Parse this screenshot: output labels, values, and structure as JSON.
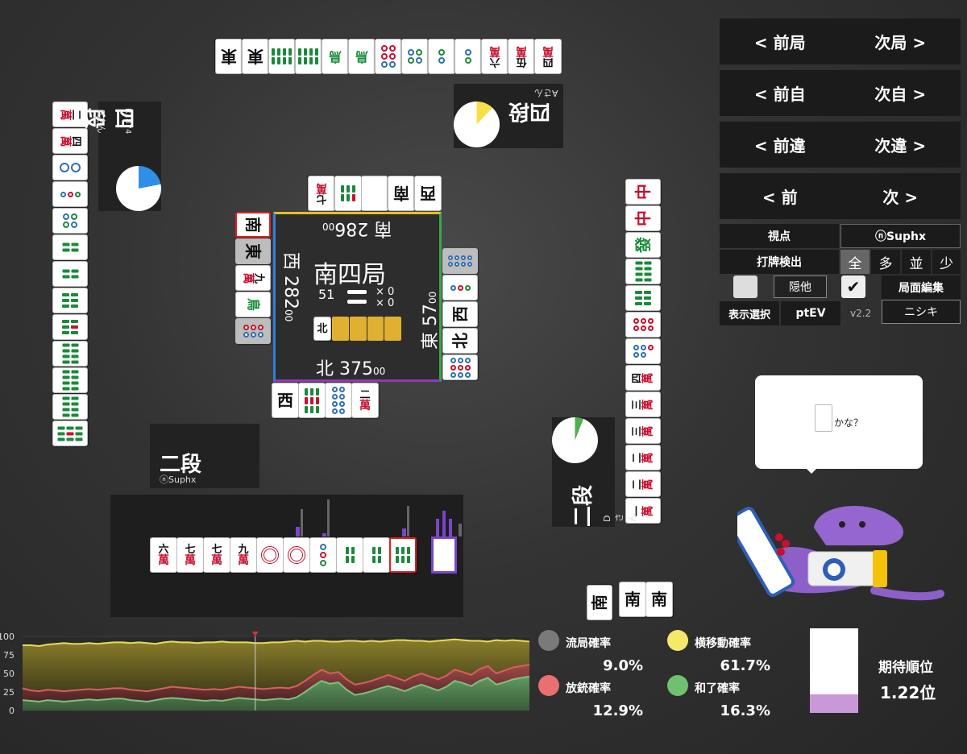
{
  "players": {
    "top": {
      "rank": "四段",
      "name": "Aさん"
    },
    "left": {
      "rank": "四段",
      "name": "Bさん",
      "rating": "R1874"
    },
    "right": {
      "rank": "二段",
      "name": "Dさん"
    },
    "self": {
      "rank": "二段",
      "name": "ⓝSuphx"
    }
  },
  "pies": {
    "top": {
      "fraction": 0.12,
      "color": "#f5e04a"
    },
    "left": {
      "fraction": 0.22,
      "color": "#2f8fe8"
    },
    "right": {
      "fraction": 0.06,
      "color": "#4caf50"
    }
  },
  "center": {
    "round": "南四局",
    "honba": "51",
    "riichi_sticks": "× 0",
    "honba_sticks": "× 0",
    "south_label": "南",
    "south_score": "286",
    "west_label": "西",
    "west_score": "282",
    "east_label": "東",
    "east_score": "57",
    "north_label": "北",
    "north_score": "375",
    "score_suffix": "00",
    "dora_indicator": "北"
  },
  "nav": {
    "prev_round": "< 前局",
    "next_round": "次局 >",
    "prev_self": "< 前自",
    "next_self": "次自 >",
    "prev_diff": "< 前違",
    "next_diff": "次違 >",
    "prev": "< 前",
    "next": "次 >"
  },
  "controls": {
    "viewpoint_label": "視点",
    "viewpoint_value": "ⓝSuphx",
    "discard_detect_label": "打牌検出",
    "filter_all": "全",
    "filter_many": "多",
    "filter_avg": "並",
    "filter_few": "少",
    "hide_others": "隠他",
    "board_edit": "局面編集",
    "display_select": "表示選択",
    "pt_ev": "ptEV",
    "version": "v2.2",
    "nishiki": "ニシキ"
  },
  "bubble": {
    "text": "かな？"
  },
  "stats": {
    "draw_label": "流局確率",
    "draw_value": "9.0%",
    "draw_color": "#7a7a7a",
    "move_label": "横移動確率",
    "move_value": "61.7%",
    "move_color": "#f5e96a",
    "deal_in_label": "放銃確率",
    "deal_in_value": "12.9%",
    "deal_in_color": "#e87070",
    "win_label": "和了確率",
    "win_value": "16.3%",
    "win_color": "#70c070",
    "expected_rank_label": "期待順位",
    "expected_rank_value": "1.22位",
    "expected_rank_fraction": 0.22
  },
  "chart_data": {
    "type": "area",
    "ylim": [
      0,
      100
    ],
    "yticks": [
      "100",
      "75",
      "50",
      "25",
      "0"
    ],
    "marker_index": 28,
    "series": [
      {
        "name": "",
        "color": "#e6dc5a",
        "values": [
          88,
          88,
          87,
          89,
          90,
          91,
          90,
          90,
          91,
          90,
          91,
          92,
          92,
          91,
          92,
          91,
          90,
          92,
          93,
          92,
          92,
          91,
          92,
          92,
          93,
          92,
          92,
          92,
          91,
          91,
          92,
          92,
          93,
          94,
          93,
          94,
          94,
          93,
          93,
          94,
          94,
          93,
          94,
          93,
          94,
          95,
          95,
          94,
          94,
          93,
          94,
          95,
          96,
          95,
          94,
          94,
          93,
          95,
          94,
          95,
          94,
          93
        ]
      },
      {
        "name": "",
        "color": "#d86060",
        "values": [
          30,
          27,
          26,
          28,
          27,
          26,
          27,
          28,
          29,
          28,
          29,
          30,
          30,
          28,
          27,
          26,
          28,
          30,
          32,
          31,
          30,
          29,
          28,
          29,
          28,
          30,
          32,
          31,
          30,
          29,
          30,
          31,
          30,
          33,
          40,
          48,
          55,
          50,
          52,
          42,
          35,
          37,
          40,
          44,
          48,
          44,
          40,
          46,
          50,
          46,
          42,
          47,
          55,
          52,
          48,
          56,
          60,
          50,
          54,
          58,
          60,
          62
        ]
      },
      {
        "name": "",
        "color": "#7fc07f",
        "values": [
          14,
          13,
          12,
          14,
          13,
          12,
          13,
          14,
          15,
          14,
          15,
          16,
          16,
          14,
          13,
          12,
          14,
          16,
          17,
          16,
          15,
          14,
          13,
          14,
          13,
          15,
          17,
          16,
          15,
          14,
          15,
          16,
          15,
          18,
          25,
          33,
          40,
          36,
          38,
          28,
          21,
          23,
          26,
          30,
          33,
          30,
          26,
          31,
          35,
          31,
          27,
          32,
          40,
          37,
          33,
          40,
          44,
          35,
          38,
          42,
          44,
          46
        ]
      }
    ]
  }
}
